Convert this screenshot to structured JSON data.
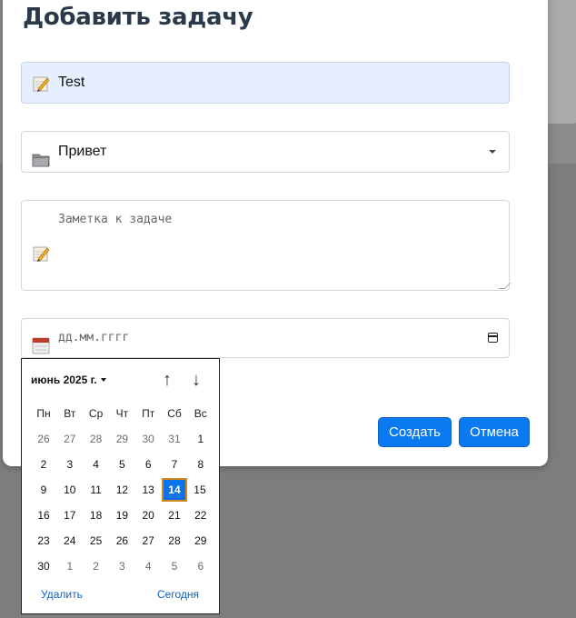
{
  "modal": {
    "title": "Добавить задачу",
    "task_input": {
      "value": "Test",
      "icon": "pencil-memo-icon"
    },
    "folder_select": {
      "value": "Привет",
      "icon": "folder-icon"
    },
    "note_textarea": {
      "placeholder": "Заметка к задаче",
      "icon": "pencil-memo-icon"
    },
    "date_input": {
      "placeholder": "дд.мм.гггг",
      "icon": "calendar-icon"
    },
    "buttons": {
      "create": "Создать",
      "cancel": "Отмена"
    }
  },
  "datepicker": {
    "month_label": "июнь 2025 г.",
    "weekdays": [
      "Пн",
      "Вт",
      "Ср",
      "Чт",
      "Пт",
      "Сб",
      "Вс"
    ],
    "weeks": [
      [
        "26",
        "27",
        "28",
        "29",
        "30",
        "31",
        "1"
      ],
      [
        "2",
        "3",
        "4",
        "5",
        "6",
        "7",
        "8"
      ],
      [
        "9",
        "10",
        "11",
        "12",
        "13",
        "14",
        "15"
      ],
      [
        "16",
        "17",
        "18",
        "19",
        "20",
        "21",
        "22"
      ],
      [
        "23",
        "24",
        "25",
        "26",
        "27",
        "28",
        "29"
      ],
      [
        "30",
        "1",
        "2",
        "3",
        "4",
        "5",
        "6"
      ]
    ],
    "selected_day": "14",
    "clear_label": "Удалить",
    "today_label": "Сегодня"
  },
  "colors": {
    "accent": "#0b7af0",
    "overlay": "#7c7d7f",
    "selected_outline": "#d08a1a"
  }
}
